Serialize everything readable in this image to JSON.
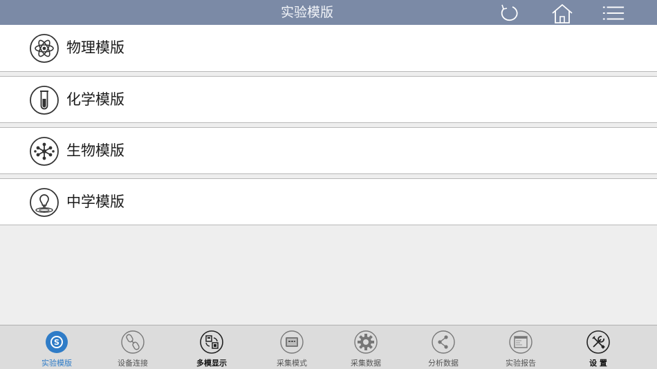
{
  "header": {
    "title": "实验模版",
    "icons": [
      "refresh-icon",
      "home-icon",
      "menu-list-icon"
    ]
  },
  "templates": [
    {
      "label": "物理模版",
      "icon": "atom-icon"
    },
    {
      "label": "化学模版",
      "icon": "test-tube-icon"
    },
    {
      "label": "生物模版",
      "icon": "molecule-icon"
    },
    {
      "label": "中学模版",
      "icon": "lightbulb-icon"
    }
  ],
  "tabbar": {
    "items": [
      {
        "label": "实验模版",
        "icon": "logo-s-icon",
        "active": true
      },
      {
        "label": "设备连接",
        "icon": "link-icon"
      },
      {
        "label": "多模显示",
        "icon": "multi-display-icon"
      },
      {
        "label": "采集模式",
        "icon": "collect-mode-icon"
      },
      {
        "label": "采集数据",
        "icon": "gear-icon"
      },
      {
        "label": "分析数据",
        "icon": "share-icon"
      },
      {
        "label": "实验报告",
        "icon": "report-icon"
      },
      {
        "label": "设 置",
        "icon": "tools-icon"
      }
    ]
  },
  "colors": {
    "header_bg": "#7b8aa6",
    "active_tab": "#2f7cc7",
    "list_bg": "#ffffff",
    "page_bg": "#eeeeee"
  }
}
